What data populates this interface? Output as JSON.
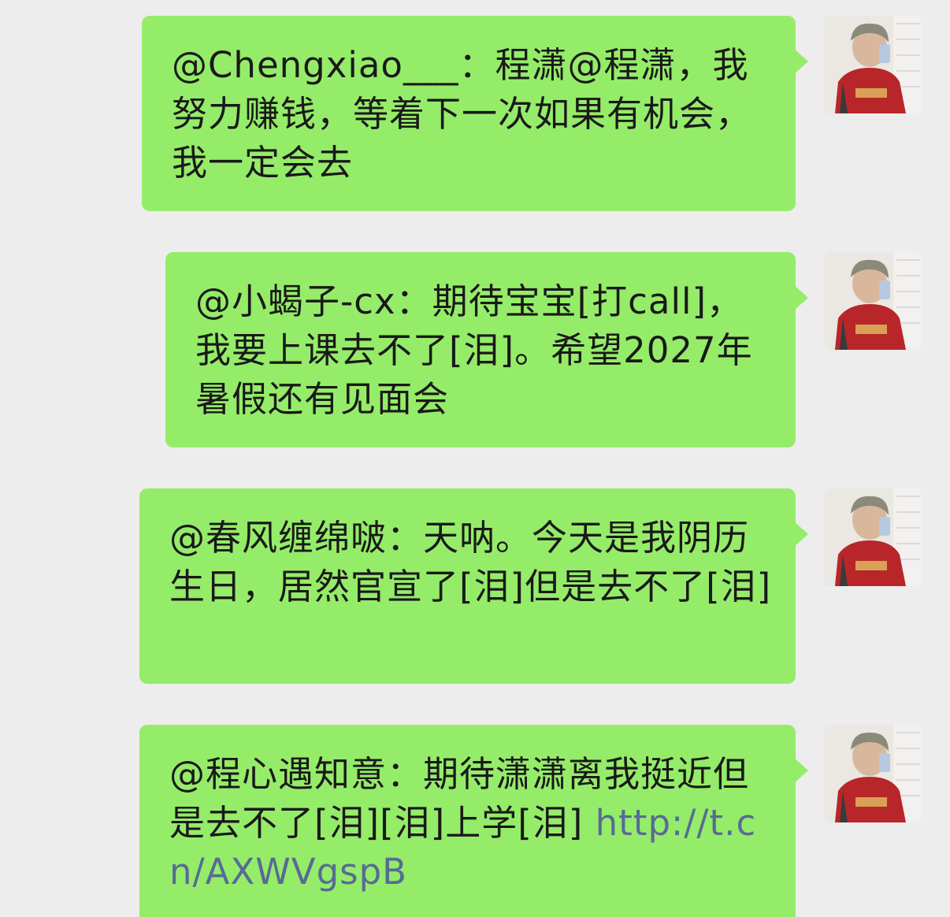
{
  "chat": {
    "messages": [
      {
        "text": "@Chengxiao___：程潇@程潇，我努力赚钱，等着下一次如果有机会，我一定会去",
        "link": ""
      },
      {
        "text": "@小蝎子-cx：期待宝宝[打call]，我要上课去不了[泪]。希望2027年暑假还有见面会",
        "link": ""
      },
      {
        "text": "@春风缠绵啵：天呐。今天是我阴历生日，居然官宣了[泪]但是去不了[泪]",
        "link": ""
      },
      {
        "text": "@程心遇知意：期待潇潇离我挺近但是去不了[泪][泪]上学[泪] ",
        "link": "http://t.cn/AXWVgspB"
      }
    ]
  },
  "colors": {
    "bubble": "#95ec69",
    "background": "#ededed",
    "link": "#576b95",
    "text": "#191919"
  },
  "icons": {
    "avatar": "user-avatar-photo"
  }
}
